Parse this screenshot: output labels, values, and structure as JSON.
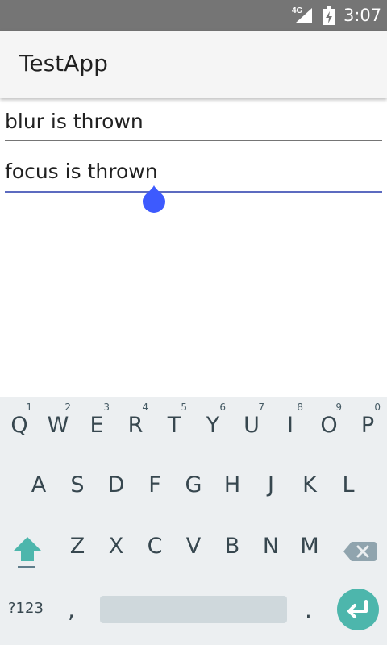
{
  "status_bar": {
    "network": "4G",
    "time": "3:07"
  },
  "app": {
    "title": "TestApp"
  },
  "fields": [
    {
      "text": "blur is thrown"
    },
    {
      "text": "focus is thrown"
    }
  ],
  "keyboard": {
    "row1": [
      {
        "key": "Q",
        "hint": "1"
      },
      {
        "key": "W",
        "hint": "2"
      },
      {
        "key": "E",
        "hint": "3"
      },
      {
        "key": "R",
        "hint": "4"
      },
      {
        "key": "T",
        "hint": "5"
      },
      {
        "key": "Y",
        "hint": "6"
      },
      {
        "key": "U",
        "hint": "7"
      },
      {
        "key": "I",
        "hint": "8"
      },
      {
        "key": "O",
        "hint": "9"
      },
      {
        "key": "P",
        "hint": "0"
      }
    ],
    "row2": [
      "A",
      "S",
      "D",
      "F",
      "G",
      "H",
      "J",
      "K",
      "L"
    ],
    "row3": [
      "Z",
      "X",
      "C",
      "V",
      "B",
      "N",
      "M"
    ],
    "symbols_label": "?123",
    "comma": ",",
    "period": "."
  },
  "colors": {
    "status_bar": "#757575",
    "accent": "#5c6bc0",
    "cursor_handle": "#3d5afe",
    "keyboard_bg": "#eceff1",
    "enter_key": "#4db6ac",
    "shift_icon": "#4db6ac"
  },
  "icons": {
    "signal": "cell-signal-icon",
    "battery": "battery-charging-icon",
    "shift": "shift-icon",
    "backspace": "backspace-icon",
    "enter": "enter-icon"
  }
}
